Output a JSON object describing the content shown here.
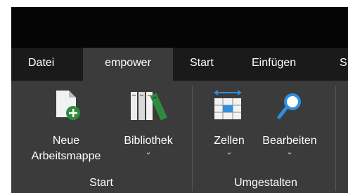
{
  "tabs": {
    "datei": "Datei",
    "empower": "empower",
    "start": "Start",
    "einfuegen": "Einfügen",
    "overflow": "S"
  },
  "ribbon": {
    "groups": {
      "start_label": "Start",
      "umgestalten_label": "Umgestalten"
    },
    "buttons": {
      "neue_line1": "Neue",
      "neue_line2": "Arbeitsmappe",
      "bibliothek": "Bibliothek",
      "zellen": "Zellen",
      "bearbeiten": "Bearbeiten",
      "dropdown_glyph": "⌄"
    }
  },
  "colors": {
    "title_bar": "#050505",
    "tab_bar": "#1a1a1a",
    "ribbon": "#3b3b3b",
    "accent_green": "#2e8b3e",
    "accent_blue": "#2f8fe0"
  },
  "icons": {
    "new_workbook": "document-plus-icon",
    "library": "books-icon",
    "cells": "table-cells-icon",
    "edit": "magnifier-icon"
  }
}
